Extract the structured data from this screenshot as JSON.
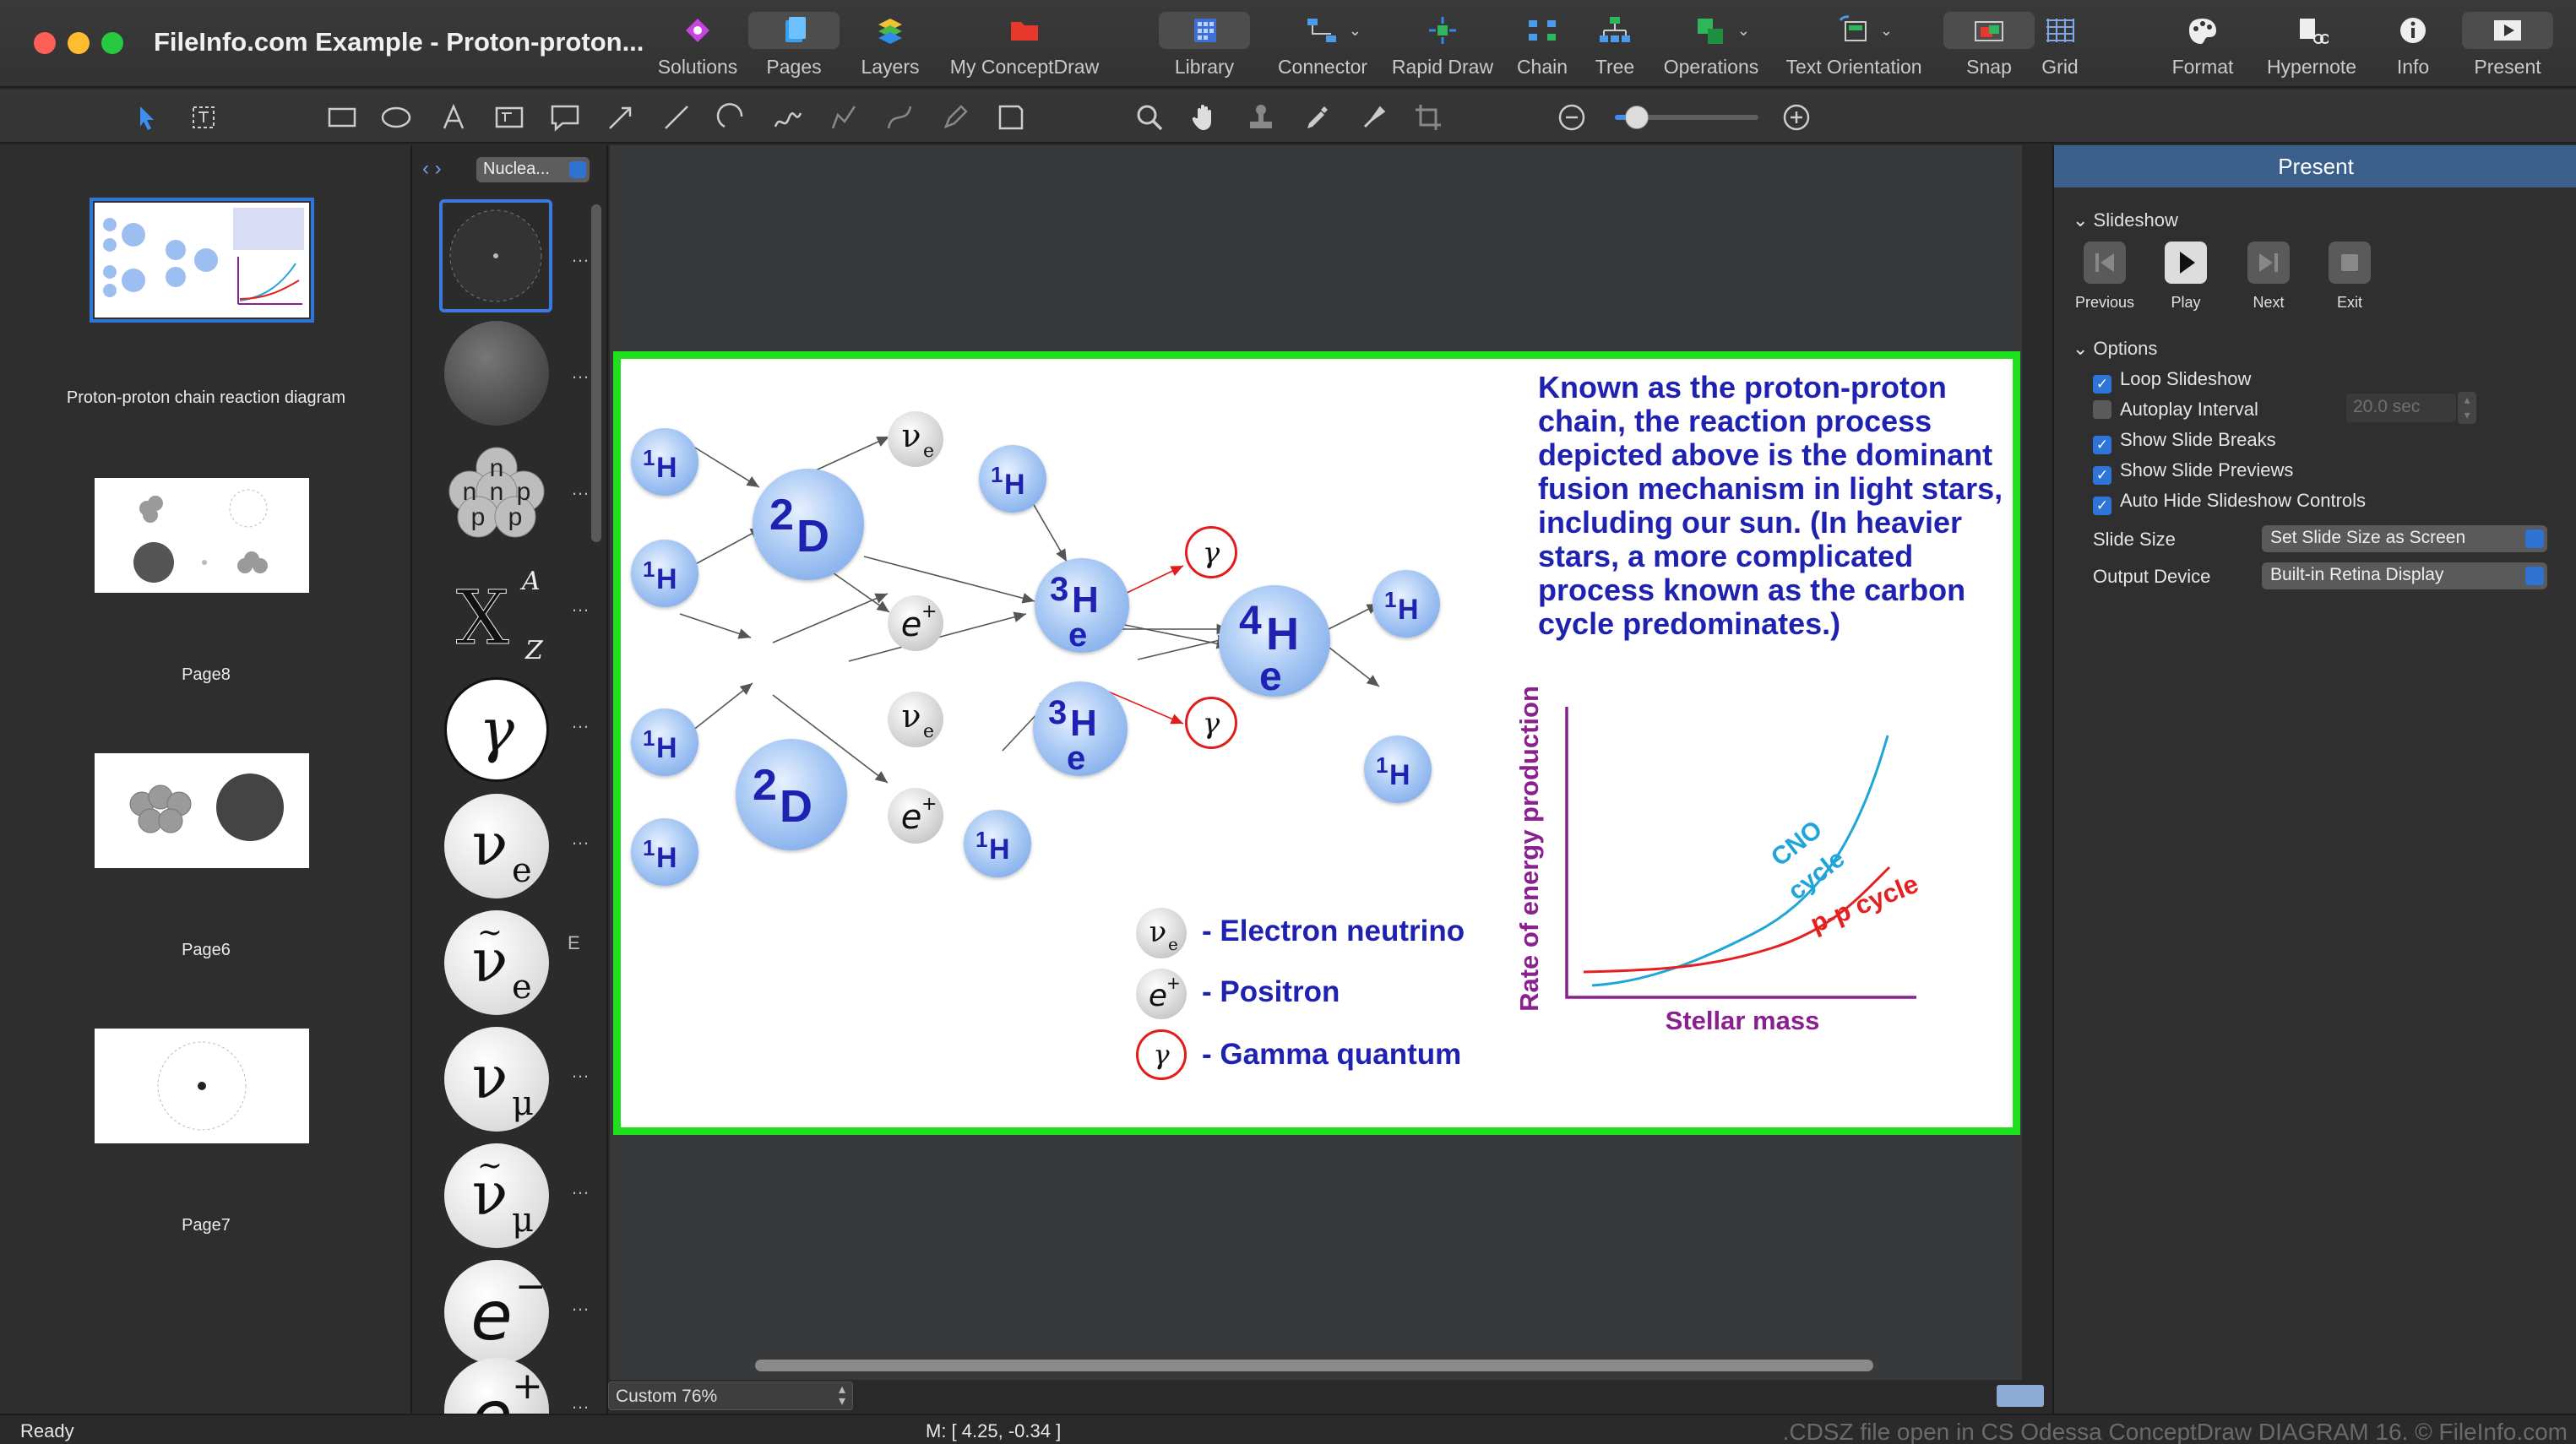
{
  "window": {
    "title": "FileInfo.com Example - Proton-proton..."
  },
  "toolbar": {
    "items": [
      {
        "label": "Solutions",
        "icon": "solutions-icon"
      },
      {
        "label": "Pages",
        "icon": "pages-icon"
      },
      {
        "label": "Layers",
        "icon": "layers-icon"
      },
      {
        "label": "My ConceptDraw",
        "icon": "folder-icon"
      },
      {
        "label": "Library",
        "icon": "library-icon"
      },
      {
        "label": "Connector",
        "icon": "connector-icon"
      },
      {
        "label": "Rapid Draw",
        "icon": "rapid-draw-icon"
      },
      {
        "label": "Chain",
        "icon": "chain-icon"
      },
      {
        "label": "Tree",
        "icon": "tree-icon"
      },
      {
        "label": "Operations",
        "icon": "operations-icon"
      },
      {
        "label": "Text Orientation",
        "icon": "text-orientation-icon"
      },
      {
        "label": "Snap",
        "icon": "snap-icon"
      },
      {
        "label": "Grid",
        "icon": "grid-icon"
      },
      {
        "label": "Format",
        "icon": "format-icon"
      },
      {
        "label": "Hypernote",
        "icon": "hypernote-icon"
      },
      {
        "label": "Info",
        "icon": "info-icon"
      },
      {
        "label": "Present",
        "icon": "present-icon"
      }
    ]
  },
  "zoom_slider": {
    "level": 0.15
  },
  "pages": [
    {
      "label": "Proton-proton chain reaction diagram",
      "current": true
    },
    {
      "label": "Page8"
    },
    {
      "label": "Page6"
    },
    {
      "label": "Page7"
    }
  ],
  "library": {
    "selected": "Nuclea...",
    "items": [
      "nucleus-icon",
      "nucleus-dark-icon",
      "neutron-proton-cluster-icon",
      "isotope-notation-icon",
      "gamma-icon",
      "electron-neutrino-icon",
      "electron-antineutrino-icon",
      "muon-neutrino-icon",
      "muon-antineutrino-icon",
      "electron-icon",
      "positron-icon"
    ],
    "side_letter": "E"
  },
  "slide": {
    "description": "Known as the proton-proton chain, the reaction process depicted above is the dominant fusion mechanism in light stars, including our sun. (In heavier stars, a more complicated process known as the carbon cycle predominates.)",
    "legend": [
      {
        "label": "- Electron neutrino"
      },
      {
        "label": "- Positron"
      },
      {
        "label": "- Gamma quantum"
      }
    ],
    "chart": {
      "ylabel": "Rate of energy production",
      "xlabel": "Stellar mass",
      "cno_label_1": "CNO",
      "cno_label_2": "cycle",
      "pp_label": "p-p cycle",
      "colors": {
        "cno": "#1fa5d8",
        "pp": "#e52020",
        "axis": "#8a1f8f"
      }
    }
  },
  "present_panel": {
    "header": "Present",
    "slideshow_title": "Slideshow",
    "buttons": [
      {
        "label": "Previous"
      },
      {
        "label": "Play"
      },
      {
        "label": "Next"
      },
      {
        "label": "Exit"
      }
    ],
    "options_title": "Options",
    "options": [
      {
        "label": "Loop Slideshow",
        "checked": true
      },
      {
        "label": "Autoplay Interval",
        "checked": false
      },
      {
        "label": "Show Slide Breaks",
        "checked": true
      },
      {
        "label": "Show Slide Previews",
        "checked": true
      },
      {
        "label": "Auto Hide Slideshow Controls",
        "checked": true
      }
    ],
    "autoplay_value": "20.0 sec",
    "slide_size_label": "Slide Size",
    "slide_size_value": "Set Slide Size as Screen",
    "output_label": "Output Device",
    "output_value": "Built-in Retina Display"
  },
  "canvas_zoom": "Custom 76%",
  "status": {
    "left": "Ready",
    "coords": "M: [ 4.25, -0.34 ]",
    "watermark": ".CDSZ file open in CS Odessa ConceptDraw DIAGRAM 16. © FileInfo.com"
  }
}
